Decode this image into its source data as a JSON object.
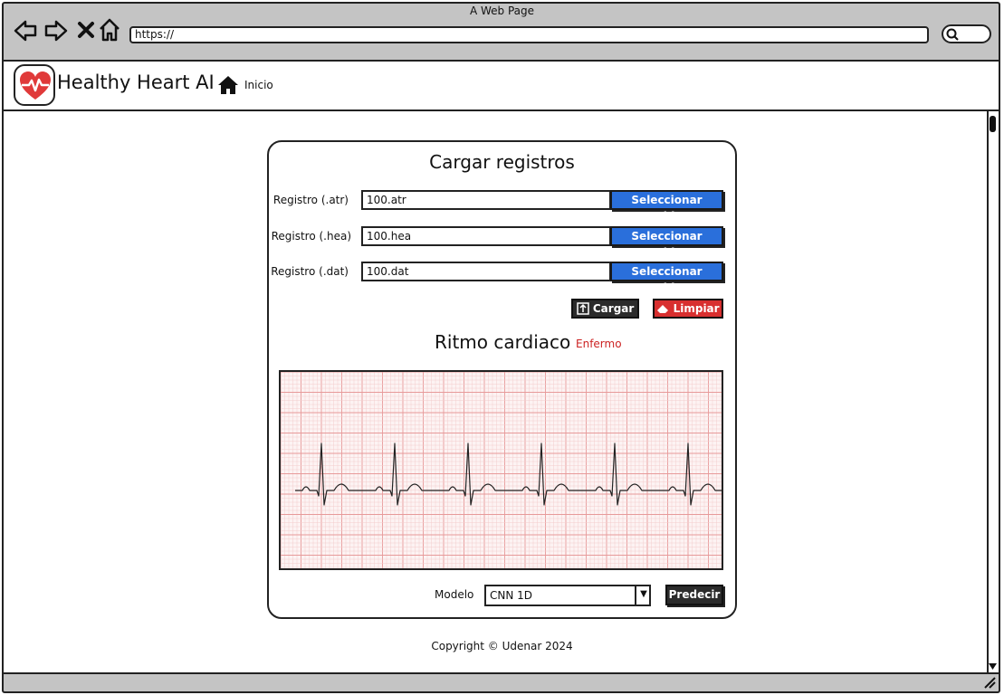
{
  "browser": {
    "window_title": "A Web Page",
    "url": "https://",
    "nav_icons": [
      "back-icon",
      "forward-icon",
      "close-icon",
      "home-icon"
    ]
  },
  "header": {
    "app_title": "Healthy Heart AI",
    "nav_home_label": "Inicio"
  },
  "upload": {
    "title": "Cargar registros",
    "rows": [
      {
        "label": "Registro (.atr)",
        "value": "100.atr",
        "button": "Seleccionar archivo"
      },
      {
        "label": "Registro (.hea)",
        "value": "100.hea",
        "button": "Seleccionar archivo"
      },
      {
        "label": "Registro (.dat)",
        "value": "100.dat",
        "button": "Seleccionar archivo"
      }
    ],
    "load_button": "Cargar",
    "clear_button": "Limpiar"
  },
  "rhythm": {
    "title": "Ritmo cardiaco",
    "status": "Enfermo",
    "status_color": "#cc2222"
  },
  "prediction": {
    "model_label": "Modelo",
    "model_value": "CNN 1D",
    "predict_button": "Predecir"
  },
  "footer": {
    "copyright": "Copyright © Udenar 2024"
  },
  "colors": {
    "accent_blue": "#2a6fdb",
    "danger_red": "#d82f2f",
    "dark_button": "#2b2b2b",
    "chrome_gray": "#c4c4c4"
  }
}
